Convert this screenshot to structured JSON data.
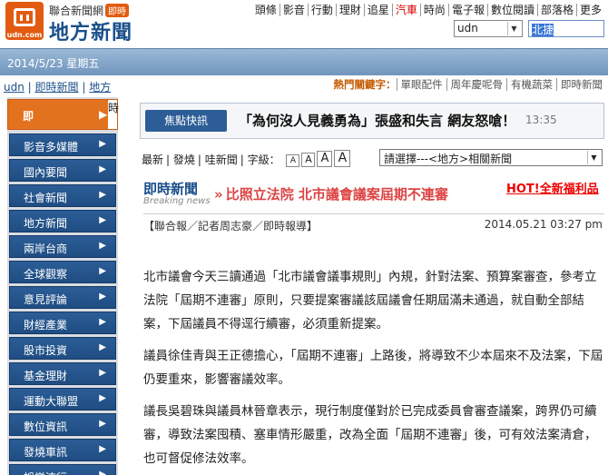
{
  "header": {
    "logo_text": "udn.com",
    "logo_top": "聯合新聞網",
    "logo_badge": "即時",
    "logo_main": "地方新聞",
    "topnav": [
      "頭條",
      "影音",
      "行動",
      "理財",
      "追星",
      "汽車",
      "時尚",
      "電子報",
      "數位閱讀",
      "部落格",
      "更多"
    ],
    "topnav_highlight": "汽車",
    "search_scope": "udn",
    "search_value": "北捷"
  },
  "date": "2014/5/23 星期五",
  "breadcrumb": [
    "udn",
    "即時新聞",
    "地方"
  ],
  "hot_keywords": {
    "label": "熱門關鍵字：",
    "items": [
      "單眼配件",
      "周年慶呢骨",
      "有機蔬菜",
      "即時新聞"
    ]
  },
  "sidebar": {
    "first": {
      "label": "即",
      "tail": "時"
    },
    "items": [
      "影音多媒體",
      "國內要聞",
      "社會新聞",
      "地方新聞",
      "兩岸台商",
      "全球觀察",
      "意見評論",
      "財經產業",
      "股市投資",
      "基金理財",
      "運動大聯盟",
      "數位資訊",
      "發燒車訊",
      "娛樂流行"
    ]
  },
  "quick_news": {
    "tag": "焦點快訊",
    "headline": "「為何沒人見義勇為」張盛和失言 網友怒嗆！",
    "time": "13:35"
  },
  "toolbar": {
    "links": [
      "最新",
      "發燒",
      "哇新聞",
      "字級："
    ],
    "font_sizes": [
      "A",
      "A",
      "A",
      "A"
    ],
    "related_select": "請選擇---<地方>相關新聞"
  },
  "article": {
    "section": "即時新聞",
    "section_en": "Breaking news",
    "title": "比照立法院 北市議會議案屆期不連審",
    "promo": "HOT!全新福利品",
    "byline": "【聯合報／記者周志豪／即時報導】",
    "published": "2014.05.21 03:27 pm",
    "paragraphs": [
      "北市議會今天三讀通過「北市議會議事規則」內規，針對法案、預算案審查，參考立法院「屆期不連審」原則，只要提案審議該屆議會任期屆滿未通過，就自動全部結案，下屆議員不得逕行續審，必須重新提案。",
      "議員徐佳青與王正德擔心，「屆期不連審」上路後，將導致不少本屆來不及法案，下屆仍要重來，影響審議效率。",
      "議長吳碧珠與議員林晉章表示，現行制度僅對於已完成委員會審查議案，跨界仍可續審，導致法案囤積、塞車情形嚴重，改為全面「屆期不連審」後，可有效法案清倉，也可督促修法效率。"
    ]
  }
}
